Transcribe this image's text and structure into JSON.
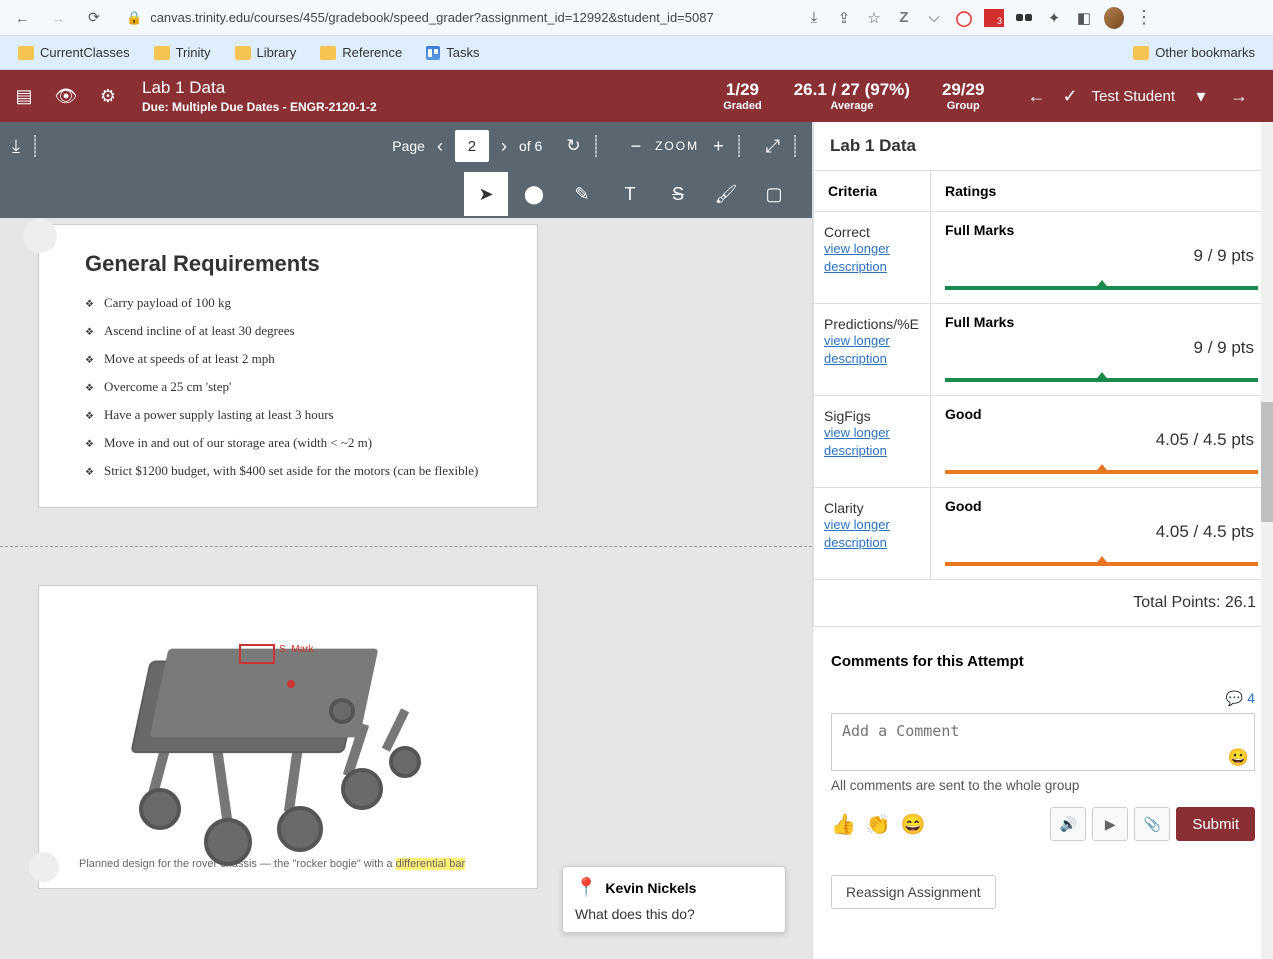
{
  "browser": {
    "url": "canvas.trinity.edu/courses/455/gradebook/speed_grader?assignment_id=12992&student_id=5087",
    "bookmarks": [
      "CurrentClasses",
      "Trinity",
      "Library",
      "Reference",
      "Tasks"
    ],
    "other_bookmarks": "Other bookmarks"
  },
  "header": {
    "title": "Lab 1 Data",
    "due": "Due: Multiple Due Dates - ENGR-2120-1-2",
    "stats": [
      {
        "value": "1/29",
        "label": "Graded"
      },
      {
        "value": "26.1 / 27 (97%)",
        "label": "Average"
      },
      {
        "value": "29/29",
        "label": "Group"
      }
    ],
    "student": "Test Student"
  },
  "viewer": {
    "page_label": "Page",
    "page_value": "2",
    "page_of": "of 6",
    "zoom_label": "ZOOM"
  },
  "document": {
    "heading": "General Requirements",
    "bullets": [
      "Carry payload of 100 kg",
      "Ascend incline of at least 30 degrees",
      "Move at speeds of at least 2 mph",
      "Overcome a 25 cm 'step'",
      "Have a power supply lasting at least 3 hours",
      "Move in and out of our storage area (width < ~2 m)",
      "Strict $1200 budget, with $400 set aside for the motors (can be flexible)"
    ],
    "caption_pre": "Planned design for the rover chassis — the \"rocker bogie\" with a ",
    "caption_hl": "differential bar",
    "red_label": "S. Mark"
  },
  "annotation": {
    "author": "Kevin Nickels",
    "text": "What does this do?"
  },
  "rubric": {
    "title": "Lab 1 Data",
    "criteria_label": "Criteria",
    "ratings_label": "Ratings",
    "link_line1": "view longer",
    "link_line2": "description",
    "rows": [
      {
        "criterion": "Correct",
        "rating_label": "Full Marks",
        "points": "9 / 9 pts",
        "color": "green",
        "pos": 50
      },
      {
        "criterion": "Predictions/%E",
        "rating_label": "Full Marks",
        "points": "9 / 9 pts",
        "color": "green",
        "pos": 50
      },
      {
        "criterion": "SigFigs",
        "rating_label": "Good",
        "points": "4.05 / 4.5 pts",
        "color": "orange",
        "pos": 50
      },
      {
        "criterion": "Clarity",
        "rating_label": "Good",
        "points": "4.05 / 4.5 pts",
        "color": "orange",
        "pos": 50
      }
    ],
    "total": "Total Points: 26.1"
  },
  "comments": {
    "heading": "Comments for this Attempt",
    "count": "4",
    "placeholder": "Add a Comment",
    "note": "All comments are sent to the whole group",
    "submit": "Submit",
    "reassign": "Reassign Assignment"
  }
}
